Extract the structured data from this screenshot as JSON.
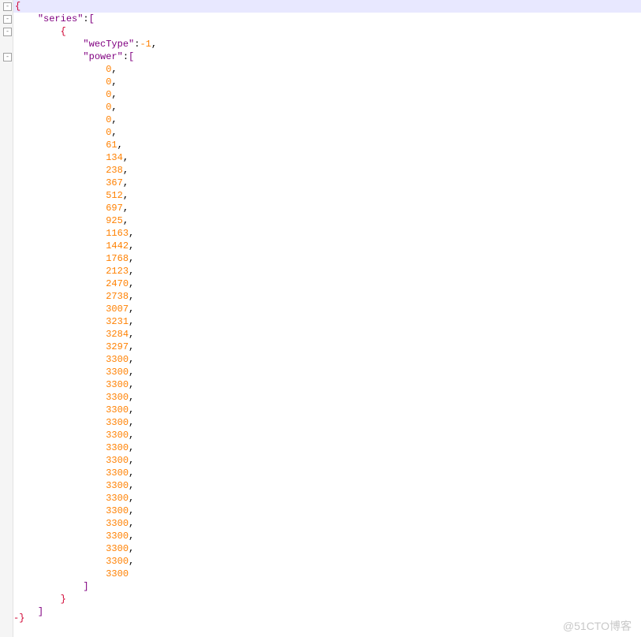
{
  "watermark": "@51CTO博客",
  "foldIcon": "-",
  "json": {
    "openBrace": "{",
    "seriesKey": "\"series\"",
    "wecTypeKey": "\"wecType\"",
    "wecTypeVal": "-1",
    "powerKey": "\"power\"",
    "powerValues": [
      "0",
      "0",
      "0",
      "0",
      "0",
      "0",
      "61",
      "134",
      "238",
      "367",
      "512",
      "697",
      "925",
      "1163",
      "1442",
      "1768",
      "2123",
      "2470",
      "2738",
      "3007",
      "3231",
      "3284",
      "3297",
      "3300",
      "3300",
      "3300",
      "3300",
      "3300",
      "3300",
      "3300",
      "3300",
      "3300",
      "3300",
      "3300",
      "3300",
      "3300",
      "3300",
      "3300",
      "3300",
      "3300",
      "3300"
    ],
    "closeBracket": "]",
    "closeBrace": "}",
    "trailingHyphen": "-}"
  },
  "indent": {
    "i1": "    ",
    "i2": "        ",
    "i3": "            ",
    "i4": "                "
  }
}
